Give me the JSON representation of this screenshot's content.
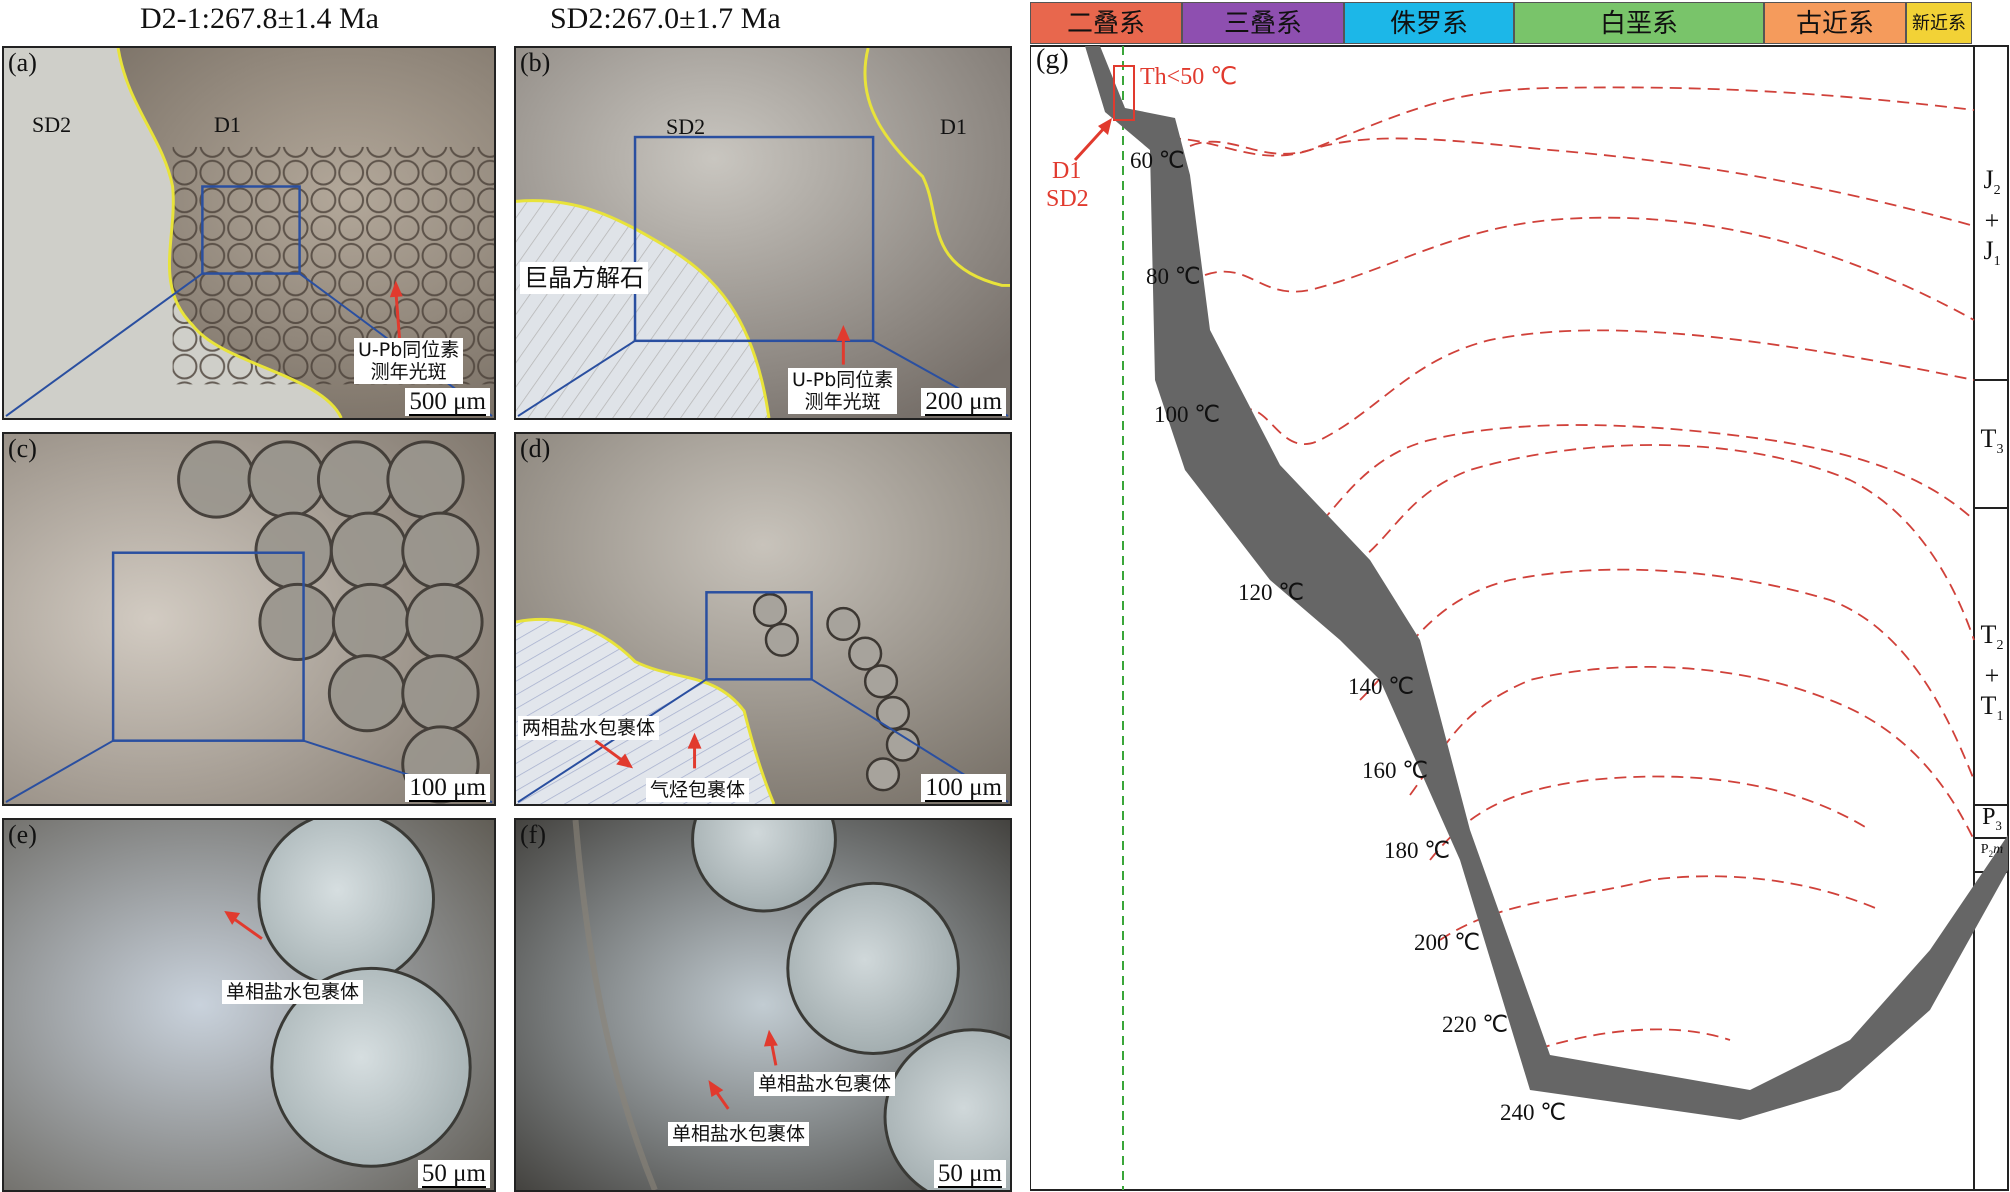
{
  "titles": {
    "left": "D2-1:267.8±1.4 Ma",
    "right": "SD2:267.0±1.7 Ma"
  },
  "panels": {
    "a": {
      "label": "(a)",
      "scale": "500 μm",
      "zone_left": "SD2",
      "zone_right": "D1",
      "spot_label_1": "U-Pb同位素",
      "spot_label_2": "测年光斑"
    },
    "b": {
      "label": "(b)",
      "scale": "200 μm",
      "zone_left": "SD2",
      "zone_right": "D1",
      "mineral": "巨晶方解石",
      "spot_label_1": "U-Pb同位素",
      "spot_label_2": "测年光斑"
    },
    "c": {
      "label": "(c)",
      "scale": "100 μm"
    },
    "d": {
      "label": "(d)",
      "scale": "100 μm",
      "inclusion_1": "两相盐水包裹体",
      "inclusion_2": "气烃包裹体"
    },
    "e": {
      "label": "(e)",
      "scale": "50 μm",
      "inclusion": "单相盐水包裹体"
    },
    "f": {
      "label": "(f)",
      "scale": "50 μm",
      "inclusion_1": "单相盐水包裹体",
      "inclusion_2": "单相盐水包裹体"
    }
  },
  "burial": {
    "label": "(g)",
    "periods": [
      {
        "name": "二叠系",
        "color": "#e8674d"
      },
      {
        "name": "三叠系",
        "color": "#8e4fb0"
      },
      {
        "name": "侏罗系",
        "color": "#1cb7e8"
      },
      {
        "name": "白垩系",
        "color": "#79c46a"
      },
      {
        "name": "古近系",
        "color": "#f59b5c"
      },
      {
        "name": "新近系",
        "color": "#f2d236"
      }
    ],
    "th_label": "Th<50 ℃",
    "samples_1": "D1",
    "samples_2": "SD2",
    "isotherms": [
      "60 ℃",
      "80 ℃",
      "100 ℃",
      "120 ℃",
      "140 ℃",
      "160 ℃",
      "180 ℃",
      "200 ℃",
      "220 ℃",
      "240 ℃"
    ],
    "strata": {
      "j_top": "J",
      "j_top_sub": "2",
      "j_plus": "+",
      "j_bot": "J",
      "j_bot_sub": "1",
      "t3": "T",
      "t3_sub": "3",
      "t_top": "T",
      "t_top_sub": "2",
      "t_plus": "+",
      "t_bot": "T",
      "t_bot_sub": "1",
      "p3": "P",
      "p3_sub": "3",
      "p2m": "P",
      "p2m_sub": "2",
      "p2m_suffix": "m"
    },
    "colors": {
      "curve": "#666666",
      "isotherm": "#d0413a",
      "th_line": "#3aa63a"
    }
  }
}
